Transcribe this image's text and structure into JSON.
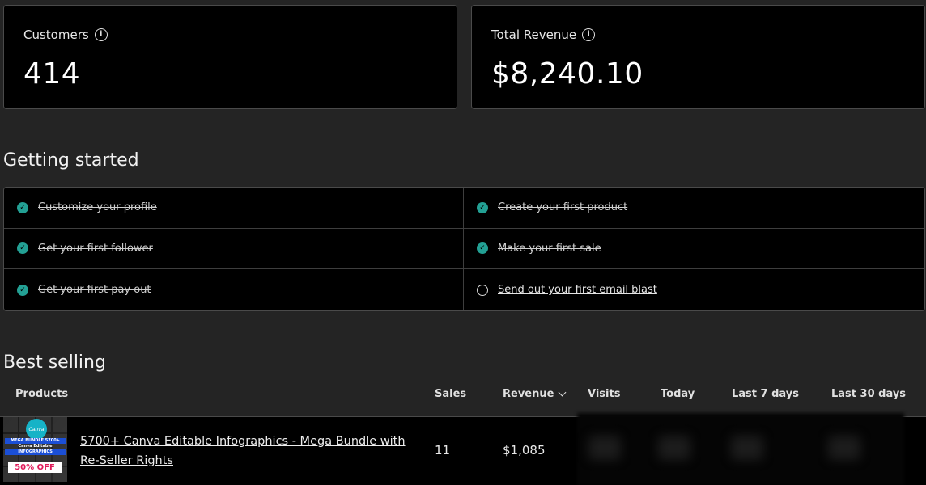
{
  "stats": {
    "customers": {
      "label": "Customers",
      "value": "414"
    },
    "revenue": {
      "label": "Total Revenue",
      "value": "$8,240.10"
    }
  },
  "getting_started": {
    "title": "Getting started",
    "items": [
      {
        "label": "Customize your profile",
        "done": true
      },
      {
        "label": "Create your first product",
        "done": true
      },
      {
        "label": "Get your first follower",
        "done": true
      },
      {
        "label": "Make your first sale",
        "done": true
      },
      {
        "label": "Get your first pay out",
        "done": true
      },
      {
        "label": "Send out your first email blast",
        "done": false
      }
    ]
  },
  "best_selling": {
    "title": "Best selling",
    "columns": {
      "products": "Products",
      "sales": "Sales",
      "revenue": "Revenue",
      "visits": "Visits",
      "today": "Today",
      "last7": "Last 7 days",
      "last30": "Last 30 days"
    },
    "rows": [
      {
        "name": "5700+ Canva Editable Infographics - Mega Bundle with Re-Seller Rights",
        "sales": "11",
        "revenue": "$1,085",
        "thumb": {
          "badge": "Canva",
          "line1": "MEGA BUNDLE 5700+",
          "line2": "Canva Editable",
          "line3": "INFOGRAPHICS",
          "off": "50% OFF"
        }
      }
    ]
  },
  "colors": {
    "check_done": "#23a094",
    "card_bg": "#000000",
    "page_bg": "#242424"
  }
}
